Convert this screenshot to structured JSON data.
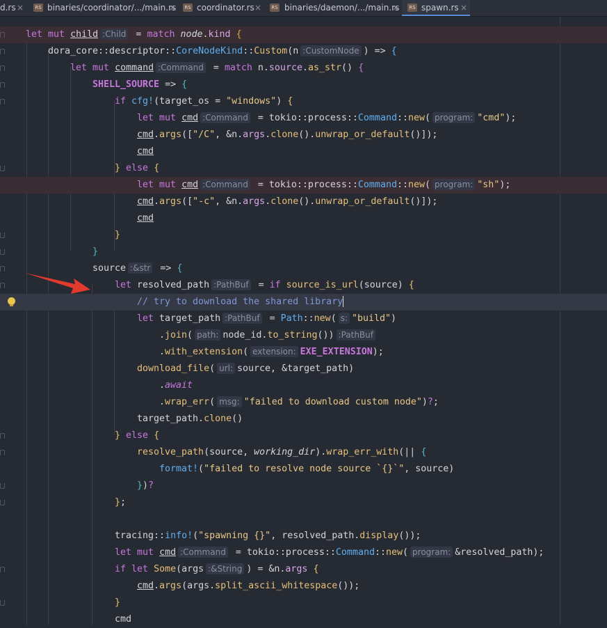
{
  "tabs": [
    {
      "label": "d.rs",
      "active": false
    },
    {
      "label": "binaries/coordinator/.../main.rs",
      "active": false
    },
    {
      "label": "coordinator.rs",
      "active": false
    },
    {
      "label": "binaries/daemon/.../main.rs",
      "active": false
    },
    {
      "label": "spawn.rs",
      "active": true
    }
  ],
  "tab_icon_text": "RS",
  "tab_close_glyph": "×",
  "hints": {
    "child": ":Child",
    "custom_node": ":CustomNode",
    "command": ":Command",
    "program": "program:",
    "str": ":&str",
    "pathbuf": ":PathBuf",
    "s": "s:",
    "path": "path:",
    "extension": "extension:",
    "url": "url:",
    "msg": "msg:",
    "string_ref": ":&String"
  },
  "strings": {
    "windows": "\"windows\"",
    "cmd": "\"cmd\"",
    "sh": "\"sh\"",
    "slash_c": "\"/C\"",
    "dash_c": "\"-c\"",
    "build": "\"build\"",
    "download_fail": "\"failed to download custom node\"",
    "resolve_fail": "\"failed to resolve node source `{}`\"",
    "spawning": "\"spawning {}\""
  },
  "comment": "// try to download the shared library",
  "colors": {
    "background": "#262a33",
    "error_line": "#3a2d33",
    "current_line": "#343945",
    "keyword": "#c678dd",
    "function": "#e5c07b",
    "type": "#61afef",
    "string": "#e7c888",
    "macro": "#56b6c2",
    "arrow": "#e23b2e"
  }
}
